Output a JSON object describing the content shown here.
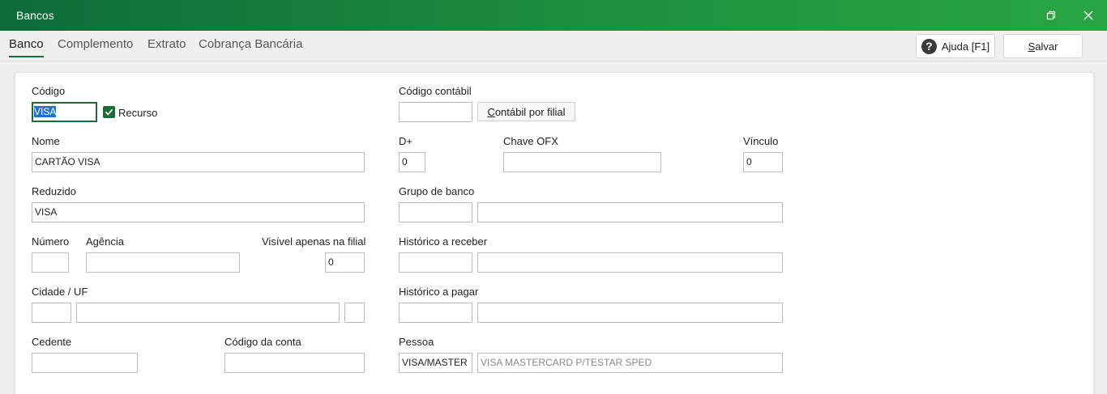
{
  "window": {
    "title": "Bancos"
  },
  "tabs": [
    {
      "label": "Banco",
      "active": true
    },
    {
      "label": "Complemento",
      "active": false
    },
    {
      "label": "Extrato",
      "active": false
    },
    {
      "label": "Cobrança Bancária",
      "active": false
    }
  ],
  "header_buttons": {
    "help": "Ajuda [F1]",
    "save_mnemonic": "S",
    "save_rest": "alvar"
  },
  "form": {
    "codigo": {
      "label": "Código",
      "value": "VISA"
    },
    "recurso": {
      "label": "Recurso",
      "checked": true
    },
    "nome": {
      "label": "Nome",
      "value": "CARTÃO VISA"
    },
    "reduzido": {
      "label": "Reduzido",
      "value": "VISA"
    },
    "numero": {
      "label": "Número",
      "value": ""
    },
    "agencia": {
      "label": "Agência",
      "value": ""
    },
    "visivel_filial": {
      "label": "Visível apenas na filial",
      "value": "0"
    },
    "cidade_uf": {
      "label": "Cidade / UF",
      "cep": "",
      "cidade": "",
      "uf": ""
    },
    "cedente": {
      "label": "Cedente",
      "value": ""
    },
    "codigo_conta": {
      "label": "Código da conta",
      "value": ""
    },
    "codigo_contabil": {
      "label": "Código contábil",
      "value": "",
      "button_mnemonic": "C",
      "button_rest": "ontábil por filial"
    },
    "d_mais": {
      "label": "D+",
      "value": "0"
    },
    "chave_ofx": {
      "label": "Chave OFX",
      "value": ""
    },
    "vinculo": {
      "label": "Vínculo",
      "value": "0"
    },
    "grupo_banco": {
      "label": "Grupo de banco",
      "code": "",
      "desc": ""
    },
    "historico_receber": {
      "label": "Histórico a receber",
      "code": "",
      "desc": ""
    },
    "historico_pagar": {
      "label": "Histórico a pagar",
      "code": "",
      "desc": ""
    },
    "pessoa": {
      "label": "Pessoa",
      "code": "VISA/MASTER",
      "desc": "VISA MASTERCARD P/TESTAR SPED"
    }
  },
  "colors": {
    "accent": "#1e6b3a",
    "titlebar_start": "#0f6b3a",
    "titlebar_end": "#2aa543",
    "selection": "#1e74d0"
  }
}
